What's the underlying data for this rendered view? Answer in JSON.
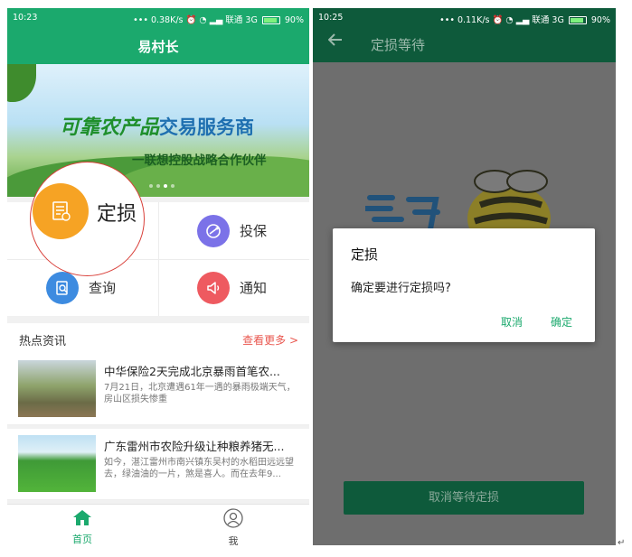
{
  "left": {
    "status": {
      "time": "10:23",
      "speed": "••• 0.38K/s",
      "carrier": "联通 3G",
      "battery": "90%"
    },
    "app_title": "易村长",
    "banner": {
      "slogan_green": "可靠农产品",
      "slogan_blue": "交易服务商",
      "slogan_sub": "一联想控股战略合作伙伴"
    },
    "menu": {
      "loss": "定损",
      "insure": "投保",
      "query": "查询",
      "notice": "通知"
    },
    "news": {
      "header": "热点资讯",
      "more": "查看更多 >",
      "items": [
        {
          "title": "中华保险2天完成北京暴雨首笔农...",
          "desc": "7月21日，北京遭遇61年一遇的暴雨极端天气，房山区损失惨重"
        },
        {
          "title": "广东雷州市农险升级让种粮养猪无...",
          "desc": "如今，湛江雷州市南兴镇东吴村的水稻田远远望去，绿油油的一片，煞是喜人。而在去年9..."
        }
      ]
    },
    "tabs": {
      "home": "首页",
      "me": "我"
    },
    "colors": {
      "primary": "#1ba96d",
      "loss": "#f6a324",
      "insure": "#7b72e8",
      "query": "#3d8be0",
      "notice": "#ee5a60",
      "more": "#e9574f"
    }
  },
  "right": {
    "status": {
      "time": "10:25",
      "speed": "••• 0.11K/s",
      "carrier": "联通 3G",
      "battery": "90%"
    },
    "page_title": "定损等待",
    "dialog": {
      "title": "定损",
      "message": "确定要进行定损吗?",
      "cancel": "取消",
      "confirm": "确定"
    },
    "bottom_button": "取消等待定损"
  },
  "return_mark": "↵"
}
